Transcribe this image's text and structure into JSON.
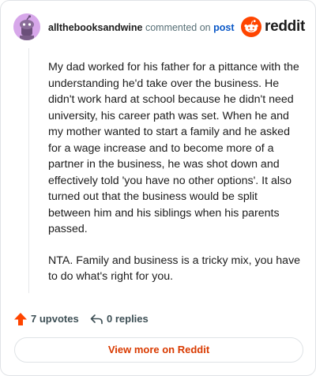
{
  "header": {
    "username": "allthebooksandwine",
    "commented_text": "commented on",
    "post_link": "post",
    "brand": "reddit"
  },
  "comment": {
    "paragraphs": [
      "My dad worked for his father for a pittance with the understanding he'd take over the business. He didn't work hard at school because he didn't need university, his career path was set. When he and my mother wanted to start a family and he asked for a wage increase and to become more of a partner in the business, he was shot down and effectively told 'you have no other options'. It also turned out that the business would be split between him and his siblings when his parents passed.",
      "NTA. Family and business is a tricky mix, you have to do what's right for you."
    ]
  },
  "actions": {
    "upvotes": "7 upvotes",
    "replies": "0 replies"
  },
  "footer": {
    "view_more": "View more on Reddit"
  },
  "colors": {
    "brand_orange": "#ff4500",
    "upvote_orange": "#ff4500",
    "link_blue": "#0a58c7",
    "view_more_text": "#d93a00",
    "avatar_bg": "#d7a7ea"
  },
  "icons": {
    "avatar": "snoo-avatar-icon",
    "brand": "reddit-logo-icon",
    "upvote": "upvote-arrow-icon",
    "reply": "reply-arrow-icon"
  }
}
